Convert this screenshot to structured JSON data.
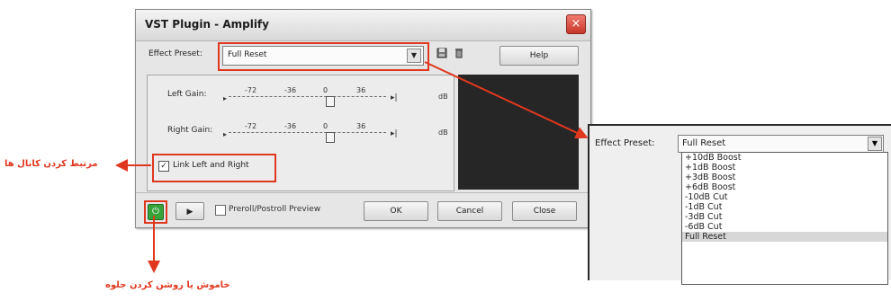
{
  "dialog": {
    "title": "VST Plugin - Amplify",
    "close_glyph": "×",
    "preset_label": "Effect Preset:",
    "preset_value": "Full Reset",
    "combo_arrow": "▼",
    "tool_icons": [
      "floppy-icon",
      "delete-icon"
    ],
    "help_label": "Help",
    "sliders": [
      {
        "label": "Left Gain:",
        "ticks": [
          "-72",
          "-36",
          "0",
          "36"
        ],
        "unit": "dB",
        "minus": "▸",
        "plus": "▸|"
      },
      {
        "label": "Right Gain:",
        "ticks": [
          "-72",
          "-36",
          "0",
          "36"
        ],
        "unit": "dB",
        "minus": "▸",
        "plus": "▸|"
      }
    ],
    "link_checkbox_glyph": "✓",
    "link_label": "Link Left and Right",
    "bottom": {
      "power_glyph": "⏻",
      "play_glyph": "▶",
      "preview_label": "Preroll/Postroll Preview",
      "ok_label": "OK",
      "cancel_label": "Cancel",
      "close_label": "Close"
    }
  },
  "annotations": {
    "link_channels": "مرتبط کردن کانال ها",
    "toggle_effect": "خاموش یا روشن کردن جلوه"
  },
  "callout": {
    "preset_label": "Effect Preset:",
    "preset_value": "Full Reset",
    "combo_arrow": "▼",
    "options": [
      "+10dB Boost",
      "+1dB Boost",
      "+3dB Boost",
      "+6dB Boost",
      "-10dB Cut",
      "-1dB Cut",
      "-3dB Cut",
      "-6dB Cut",
      "Full Reset"
    ],
    "selected": "Full Reset"
  },
  "colors": {
    "annotation_red": "#e0371f",
    "power_green": "#37a33b",
    "dark_panel": "#262626"
  }
}
